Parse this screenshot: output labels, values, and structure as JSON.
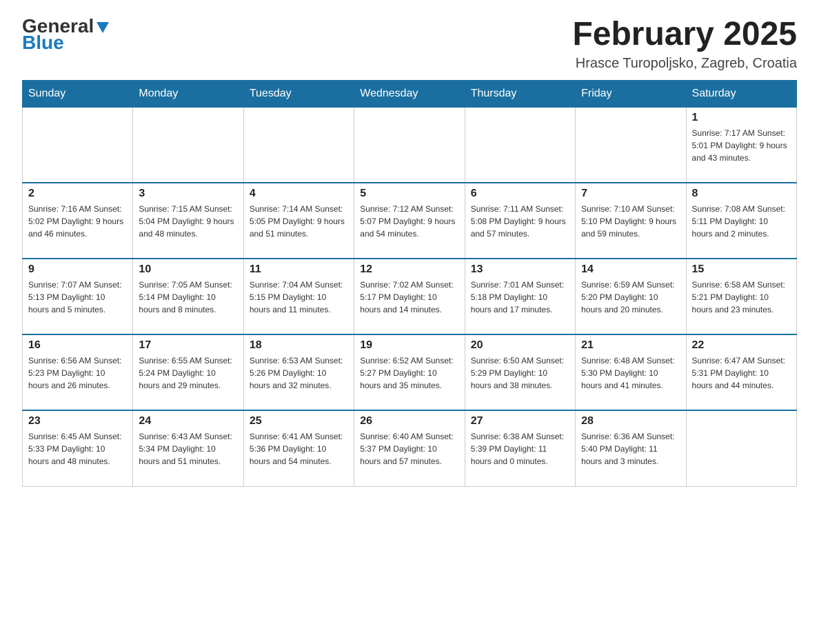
{
  "header": {
    "logo_general": "General",
    "logo_blue": "Blue",
    "title": "February 2025",
    "location": "Hrasce Turopoljsko, Zagreb, Croatia"
  },
  "days_of_week": [
    "Sunday",
    "Monday",
    "Tuesday",
    "Wednesday",
    "Thursday",
    "Friday",
    "Saturday"
  ],
  "weeks": [
    [
      {
        "day": "",
        "info": ""
      },
      {
        "day": "",
        "info": ""
      },
      {
        "day": "",
        "info": ""
      },
      {
        "day": "",
        "info": ""
      },
      {
        "day": "",
        "info": ""
      },
      {
        "day": "",
        "info": ""
      },
      {
        "day": "1",
        "info": "Sunrise: 7:17 AM\nSunset: 5:01 PM\nDaylight: 9 hours and 43 minutes."
      }
    ],
    [
      {
        "day": "2",
        "info": "Sunrise: 7:16 AM\nSunset: 5:02 PM\nDaylight: 9 hours and 46 minutes."
      },
      {
        "day": "3",
        "info": "Sunrise: 7:15 AM\nSunset: 5:04 PM\nDaylight: 9 hours and 48 minutes."
      },
      {
        "day": "4",
        "info": "Sunrise: 7:14 AM\nSunset: 5:05 PM\nDaylight: 9 hours and 51 minutes."
      },
      {
        "day": "5",
        "info": "Sunrise: 7:12 AM\nSunset: 5:07 PM\nDaylight: 9 hours and 54 minutes."
      },
      {
        "day": "6",
        "info": "Sunrise: 7:11 AM\nSunset: 5:08 PM\nDaylight: 9 hours and 57 minutes."
      },
      {
        "day": "7",
        "info": "Sunrise: 7:10 AM\nSunset: 5:10 PM\nDaylight: 9 hours and 59 minutes."
      },
      {
        "day": "8",
        "info": "Sunrise: 7:08 AM\nSunset: 5:11 PM\nDaylight: 10 hours and 2 minutes."
      }
    ],
    [
      {
        "day": "9",
        "info": "Sunrise: 7:07 AM\nSunset: 5:13 PM\nDaylight: 10 hours and 5 minutes."
      },
      {
        "day": "10",
        "info": "Sunrise: 7:05 AM\nSunset: 5:14 PM\nDaylight: 10 hours and 8 minutes."
      },
      {
        "day": "11",
        "info": "Sunrise: 7:04 AM\nSunset: 5:15 PM\nDaylight: 10 hours and 11 minutes."
      },
      {
        "day": "12",
        "info": "Sunrise: 7:02 AM\nSunset: 5:17 PM\nDaylight: 10 hours and 14 minutes."
      },
      {
        "day": "13",
        "info": "Sunrise: 7:01 AM\nSunset: 5:18 PM\nDaylight: 10 hours and 17 minutes."
      },
      {
        "day": "14",
        "info": "Sunrise: 6:59 AM\nSunset: 5:20 PM\nDaylight: 10 hours and 20 minutes."
      },
      {
        "day": "15",
        "info": "Sunrise: 6:58 AM\nSunset: 5:21 PM\nDaylight: 10 hours and 23 minutes."
      }
    ],
    [
      {
        "day": "16",
        "info": "Sunrise: 6:56 AM\nSunset: 5:23 PM\nDaylight: 10 hours and 26 minutes."
      },
      {
        "day": "17",
        "info": "Sunrise: 6:55 AM\nSunset: 5:24 PM\nDaylight: 10 hours and 29 minutes."
      },
      {
        "day": "18",
        "info": "Sunrise: 6:53 AM\nSunset: 5:26 PM\nDaylight: 10 hours and 32 minutes."
      },
      {
        "day": "19",
        "info": "Sunrise: 6:52 AM\nSunset: 5:27 PM\nDaylight: 10 hours and 35 minutes."
      },
      {
        "day": "20",
        "info": "Sunrise: 6:50 AM\nSunset: 5:29 PM\nDaylight: 10 hours and 38 minutes."
      },
      {
        "day": "21",
        "info": "Sunrise: 6:48 AM\nSunset: 5:30 PM\nDaylight: 10 hours and 41 minutes."
      },
      {
        "day": "22",
        "info": "Sunrise: 6:47 AM\nSunset: 5:31 PM\nDaylight: 10 hours and 44 minutes."
      }
    ],
    [
      {
        "day": "23",
        "info": "Sunrise: 6:45 AM\nSunset: 5:33 PM\nDaylight: 10 hours and 48 minutes."
      },
      {
        "day": "24",
        "info": "Sunrise: 6:43 AM\nSunset: 5:34 PM\nDaylight: 10 hours and 51 minutes."
      },
      {
        "day": "25",
        "info": "Sunrise: 6:41 AM\nSunset: 5:36 PM\nDaylight: 10 hours and 54 minutes."
      },
      {
        "day": "26",
        "info": "Sunrise: 6:40 AM\nSunset: 5:37 PM\nDaylight: 10 hours and 57 minutes."
      },
      {
        "day": "27",
        "info": "Sunrise: 6:38 AM\nSunset: 5:39 PM\nDaylight: 11 hours and 0 minutes."
      },
      {
        "day": "28",
        "info": "Sunrise: 6:36 AM\nSunset: 5:40 PM\nDaylight: 11 hours and 3 minutes."
      },
      {
        "day": "",
        "info": ""
      }
    ]
  ]
}
